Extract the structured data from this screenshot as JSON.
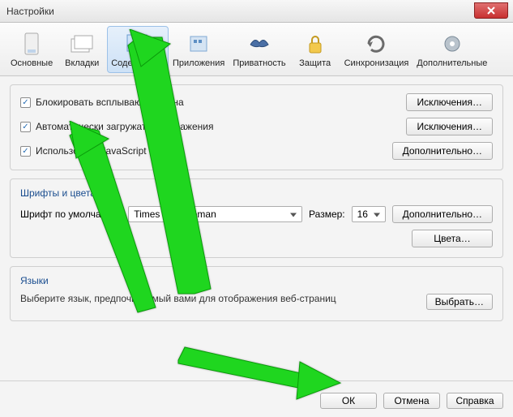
{
  "window": {
    "title": "Настройки"
  },
  "toolbar": {
    "items": [
      {
        "label": "Основные"
      },
      {
        "label": "Вкладки"
      },
      {
        "label": "Содержимое"
      },
      {
        "label": "Приложения"
      },
      {
        "label": "Приватность"
      },
      {
        "label": "Защита"
      },
      {
        "label": "Синхронизация"
      },
      {
        "label": "Дополнительные"
      }
    ]
  },
  "checks": {
    "block_popups": "Блокировать всплывающие окна",
    "autoload_images": "Автоматически загружать изображения",
    "use_js": "Использовать JavaScript"
  },
  "buttons": {
    "exceptions": "Исключения…",
    "advanced": "Дополнительно…",
    "colors": "Цвета…",
    "choose": "Выбрать…",
    "ok": "ОК",
    "cancel": "Отмена",
    "help": "Справка"
  },
  "fonts": {
    "section": "Шрифты и цвета",
    "default_font_label": "Шрифт по умолчанию:",
    "default_font_value": "Times New Roman",
    "size_label": "Размер:",
    "size_value": "16"
  },
  "langs": {
    "section": "Языки",
    "desc": "Выберите язык, предпочитаемый вами для отображения веб-страниц"
  }
}
